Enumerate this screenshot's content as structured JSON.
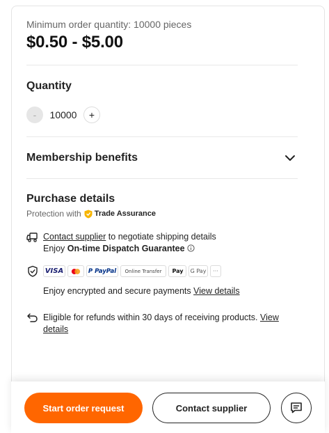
{
  "product": {
    "moq_text": "Minimum order quantity: 10000 pieces",
    "price_range": "$0.50 - $5.00"
  },
  "quantity": {
    "title": "Quantity",
    "minus": "-",
    "value": "10000",
    "plus": "+"
  },
  "membership": {
    "title": "Membership benefits",
    "icon": "chevron-down-icon"
  },
  "purchase": {
    "title": "Purchase details",
    "protection_prefix": "Protection with",
    "trade_assurance": "Trade Assurance",
    "shipping": {
      "link": "Contact supplier",
      "rest": " to negotiate shipping details",
      "line2_prefix": "Enjoy ",
      "line2_bold": "On-time Dispatch Guarantee"
    },
    "payment": {
      "methods": [
        "VISA",
        "",
        "P PayPal",
        "Online Transfer",
        "Pay",
        "G Pay",
        "···"
      ],
      "text": "Enjoy encrypted and secure payments ",
      "link": "View details"
    },
    "refund": {
      "text": "Eligible for refunds within 30 days of receiving products. ",
      "link_part1": "View",
      "link_part2": "details"
    }
  },
  "footer": {
    "start_order": "Start order request",
    "contact_supplier": "Contact supplier"
  },
  "colors": {
    "accent": "#ff6600",
    "trade_assurance_gold": "#f7b500"
  }
}
